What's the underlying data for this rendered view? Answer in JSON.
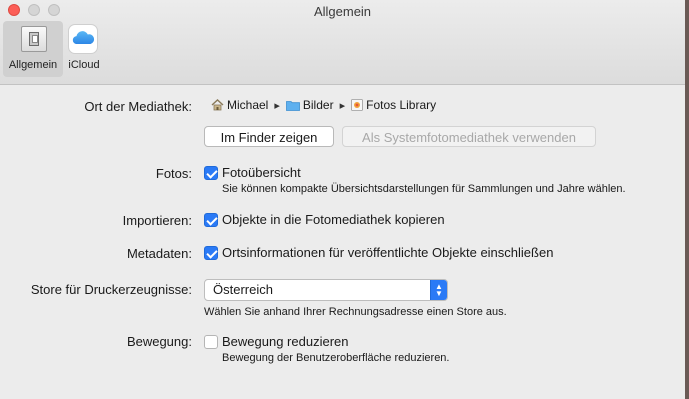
{
  "window": {
    "title": "Allgemein"
  },
  "toolbar": {
    "tabs": [
      {
        "label": "Allgemein",
        "icon": "general-icon",
        "selected": true
      },
      {
        "label": "iCloud",
        "icon": "icloud-icon",
        "selected": false
      }
    ]
  },
  "library": {
    "label": "Ort der Mediathek:",
    "path": [
      {
        "name": "Michael",
        "icon": "home-icon"
      },
      {
        "name": "Bilder",
        "icon": "folder-icon"
      },
      {
        "name": "Fotos Library",
        "icon": "photos-library-icon"
      }
    ],
    "finder_button": "Im Finder zeigen",
    "system_library_button": "Als Systemfotomediathek verwenden"
  },
  "photos": {
    "label": "Fotos:",
    "checkbox_label": "Fotoübersicht",
    "checked": true,
    "description": "Sie können kompakte Übersichtsdarstellungen für Sammlungen und Jahre wählen."
  },
  "import": {
    "label": "Importieren:",
    "checkbox_label": "Objekte in die Fotomediathek kopieren",
    "checked": true
  },
  "metadata": {
    "label": "Metadaten:",
    "checkbox_label": "Ortsinformationen für veröffentlichte Objekte einschließen",
    "checked": true
  },
  "print_store": {
    "label": "Store für Druckerzeugnisse:",
    "selected": "Österreich",
    "description": "Wählen Sie anhand Ihrer Rechnungsadresse einen Store aus."
  },
  "motion": {
    "label": "Bewegung:",
    "checkbox_label": "Bewegung reduzieren",
    "checked": false,
    "description": "Bewegung der Benutzeroberfläche reduzieren."
  },
  "colors": {
    "accent": "#2a7af6",
    "window_bg": "#ececec"
  }
}
